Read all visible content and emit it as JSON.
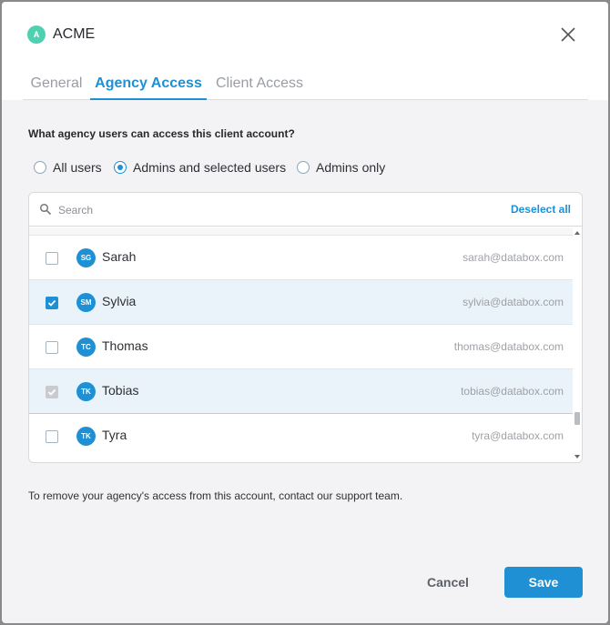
{
  "header": {
    "logo_letter": "A",
    "title": "ACME",
    "close_icon": "close-icon"
  },
  "tabs": [
    {
      "label": "General",
      "active": false
    },
    {
      "label": "Agency Access",
      "active": true
    },
    {
      "label": "Client Access",
      "active": false
    }
  ],
  "access": {
    "question": "What agency users can access this client account?",
    "options": [
      {
        "label": "All users",
        "selected": false
      },
      {
        "label": "Admins and selected users",
        "selected": true
      },
      {
        "label": "Admins only",
        "selected": false
      }
    ]
  },
  "search": {
    "placeholder": "Search",
    "value": "",
    "deselect_label": "Deselect all",
    "icon": "search-icon"
  },
  "users": [
    {
      "initials": "SG",
      "name": "Sarah",
      "email": "sarah@databox.com",
      "checked": false,
      "disabled": false
    },
    {
      "initials": "SM",
      "name": "Sylvia",
      "email": "sylvia@databox.com",
      "checked": true,
      "disabled": false
    },
    {
      "initials": "TC",
      "name": "Thomas",
      "email": "thomas@databox.com",
      "checked": false,
      "disabled": false
    },
    {
      "initials": "TK",
      "name": "Tobias",
      "email": "tobias@databox.com",
      "checked": true,
      "disabled": true
    },
    {
      "initials": "TK",
      "name": "Tyra",
      "email": "tyra@databox.com",
      "checked": false,
      "disabled": false
    }
  ],
  "footer": {
    "note": "To remove your agency's access from this account, contact our support team.",
    "cancel_label": "Cancel",
    "save_label": "Save"
  },
  "colors": {
    "accent": "#1f90d4",
    "logo": "#4fd1b1",
    "selected_row": "#e9f3f9"
  }
}
